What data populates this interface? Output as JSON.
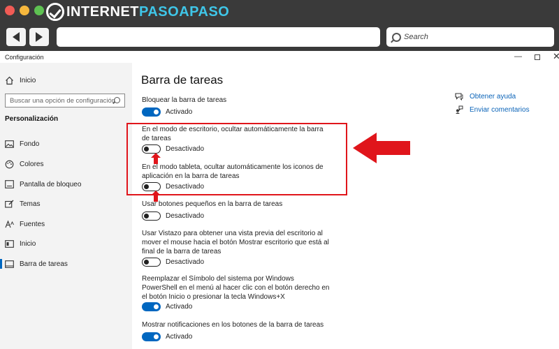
{
  "browser": {
    "logo_part1": "INTERNET",
    "logo_part2": "PASOAPASO",
    "search_label": "Search"
  },
  "window": {
    "title": "Configuración",
    "min_glyph": "—",
    "close_glyph": "✕"
  },
  "sidebar": {
    "home_label": "Inicio",
    "search_placeholder": "Buscar una opción de configuración",
    "section_heading": "Personalización",
    "items": [
      {
        "label": "Fondo",
        "icon": "image-icon"
      },
      {
        "label": "Colores",
        "icon": "palette-icon"
      },
      {
        "label": "Pantalla de bloqueo",
        "icon": "lock-screen-icon"
      },
      {
        "label": "Temas",
        "icon": "brush-icon"
      },
      {
        "label": "Fuentes",
        "icon": "font-icon"
      },
      {
        "label": "Inicio",
        "icon": "start-icon"
      },
      {
        "label": "Barra de tareas",
        "icon": "taskbar-icon"
      }
    ],
    "active_item": "Barra de tareas"
  },
  "main": {
    "title": "Barra de tareas",
    "settings": [
      {
        "text": "Bloquear la barra de tareas",
        "state": "Activado",
        "on": true
      },
      {
        "text": "En el modo de escritorio, ocultar automáticamente la barra de tareas",
        "state": "Desactivado",
        "on": false
      },
      {
        "text": "En el modo tableta, ocultar automáticamente los iconos de aplicación en la barra de tareas",
        "state": "Desactivado",
        "on": false
      },
      {
        "text": "Usar botones pequeños en la barra de tareas",
        "state": "Desactivado",
        "on": false
      },
      {
        "text": "Usar Vistazo para obtener una vista previa del escritorio al mover el mouse hacia el botón Mostrar escritorio que está al final de la barra de tareas",
        "state": "Desactivado",
        "on": false
      },
      {
        "text": "Reemplazar el Símbolo del sistema por Windows PowerShell en el menú al hacer clic con el botón derecho en el botón Inicio o presionar la tecla Windows+X",
        "state": "Activado",
        "on": true
      },
      {
        "text": "Mostrar notificaciones en los botones de la barra de tareas",
        "state": "Activado",
        "on": true
      }
    ]
  },
  "help": {
    "get_help": "Obtener ayuda",
    "send_feedback": "Enviar comentarios"
  },
  "colors": {
    "accent": "#0067c0",
    "annotation": "#e0151b",
    "chrome": "#3a3a3a"
  }
}
